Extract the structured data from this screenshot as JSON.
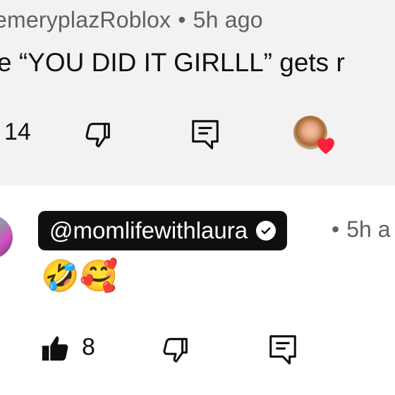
{
  "top_comment": {
    "author": "emeryplazRoblox",
    "separator": "•",
    "time": "5h ago",
    "text": "e “YOU DID IT GIRLLL” gets r",
    "like_count": "14"
  },
  "second_comment": {
    "author": "@momlifewithlaura",
    "separator": "•",
    "time": "5h a",
    "text": "🤣🥰",
    "like_count": "8"
  },
  "colors": {
    "highlight_bg": "#f2f2f2",
    "chip_bg": "#0f0f0f",
    "heart": "#ff1f3d",
    "meta_text": "#606060"
  }
}
